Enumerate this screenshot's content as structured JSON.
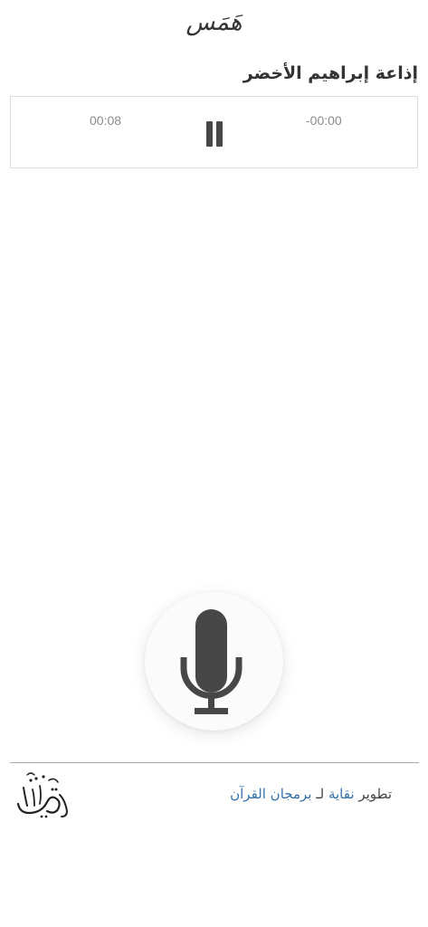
{
  "app": {
    "title": "هَمَس"
  },
  "player": {
    "station_name": "إذاعة إبراهيم الأخضر",
    "elapsed": "00:08",
    "remaining": "-00:00",
    "state": "playing",
    "pause_icon": "pause-icon"
  },
  "mic": {
    "icon": "microphone-icon",
    "color": "#474747"
  },
  "footer": {
    "credit_prefix": "تطوير",
    "developer_link": "نقاية",
    "credit_middle": "لـ",
    "program_link": "برمجان القرآن",
    "logo_text": "نقاية",
    "link_color": "#3470a8"
  }
}
